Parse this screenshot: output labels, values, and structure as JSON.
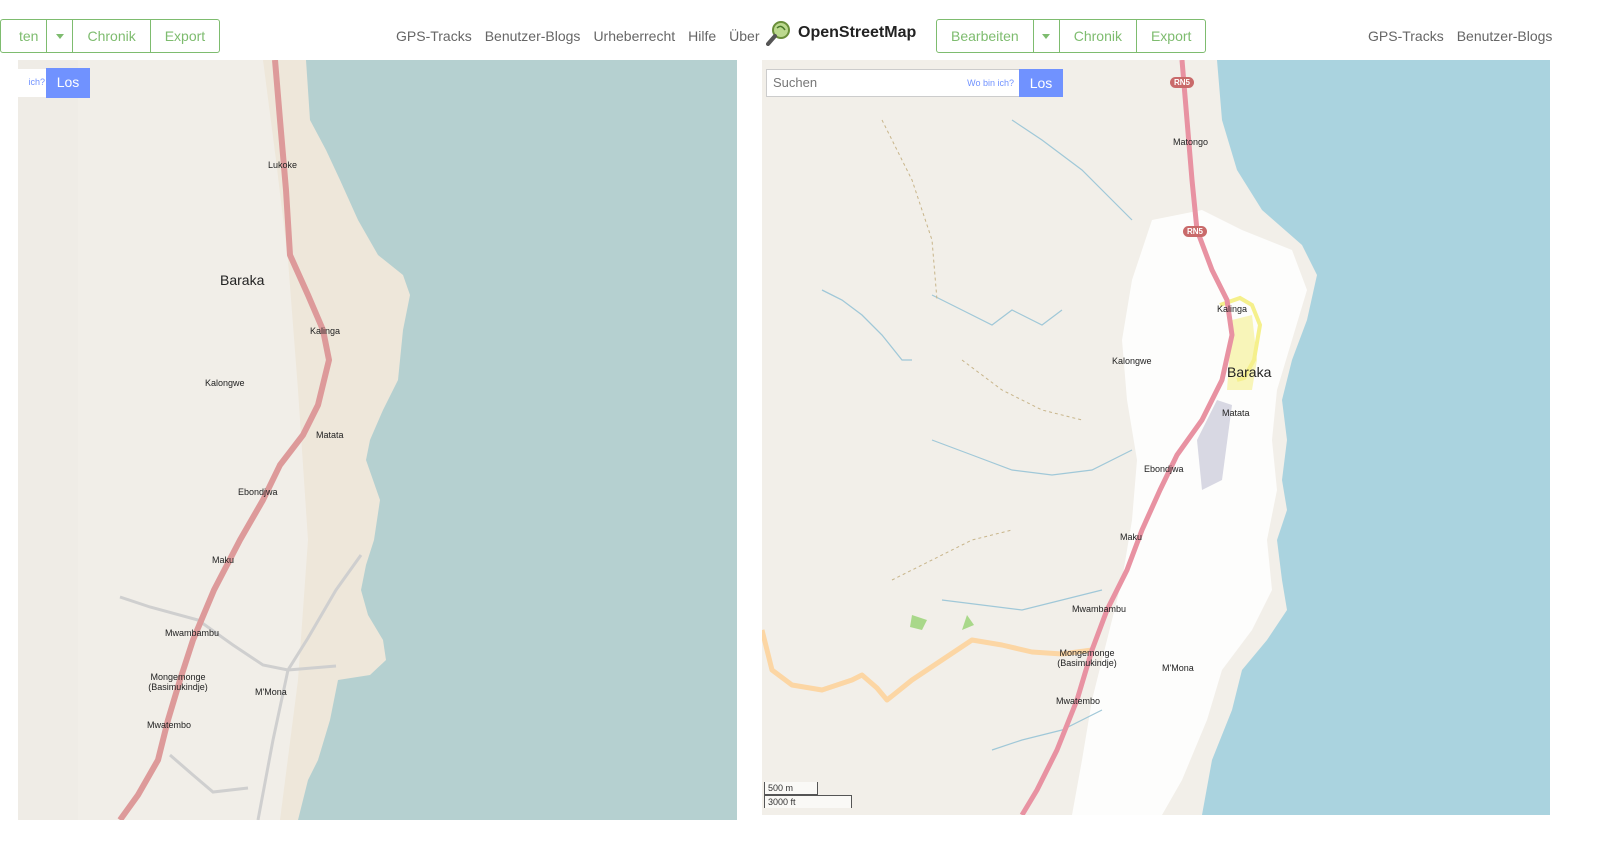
{
  "left": {
    "nav": {
      "edit_label": "ten",
      "history_label": "Chronik",
      "export_label": "Export",
      "links": [
        "GPS-Tracks",
        "Benutzer-Blogs",
        "Urheberrecht",
        "Hilfe",
        "Über"
      ]
    },
    "search": {
      "where_label": "ich?",
      "go_label": "Los"
    },
    "places": {
      "lukoke": "Lukoke",
      "baraka": "Baraka",
      "kalinga": "Kalinga",
      "kalongwe": "Kalongwe",
      "matata": "Matata",
      "ebondjwa": "Ebondjwa",
      "maku": "Maku",
      "mwambambu": "Mwambambu",
      "mongemonge": "Mongemonge",
      "basimukindje": "(Basimukindje)",
      "mmona": "M'Mona",
      "mwatembo": "Mwatembo"
    },
    "colors": {
      "land": "#f1eee8",
      "water": "#b5d0d0",
      "coast": "#eee7da",
      "road": "#dd9a9a",
      "track": "#cfcfcf"
    }
  },
  "right": {
    "brand": "OpenStreetMap",
    "nav": {
      "edit_label": "Bearbeiten",
      "history_label": "Chronik",
      "export_label": "Export",
      "links": [
        "GPS-Tracks",
        "Benutzer-Blogs"
      ]
    },
    "search": {
      "placeholder": "Suchen",
      "where_label": "Wo bin ich?",
      "go_label": "Los"
    },
    "shields": [
      "RN5",
      "RN5"
    ],
    "places": {
      "matongo": "Matongo",
      "kalinga": "Kalinga",
      "kalongwe": "Kalongwe",
      "baraka": "Baraka",
      "matata": "Matata",
      "ebondjwa": "Ebondjwa",
      "maku": "Maku",
      "mwambambu": "Mwambambu",
      "mongemonge": "Mongemonge",
      "basimukindje": "(Basimukindje)",
      "mmona": "M'Mona",
      "mwatembo": "Mwatembo"
    },
    "scale": {
      "metric": "500 m",
      "imperial": "3000 ft"
    },
    "colors": {
      "land": "#f2efe9",
      "water": "#aad3df",
      "road": "#e892a2",
      "secondary_road": "#fcd6a4",
      "residential": "#ffffff",
      "stream": "#a0c8d8",
      "accent": "#7ebc6f",
      "search_button": "#7092ff"
    }
  }
}
